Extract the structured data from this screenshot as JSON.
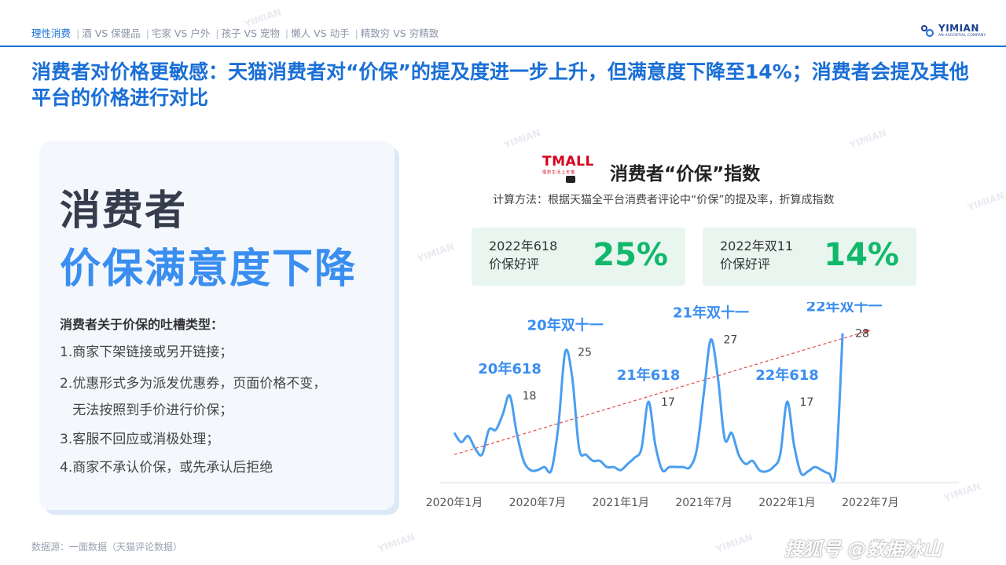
{
  "breadcrumb": {
    "active": "理性消费",
    "items": [
      "酒 VS 保健品",
      "宅家 VS 户外",
      "孩子 VS 宠物",
      "懒人 VS 动手",
      "精致穷 VS 穷精致"
    ]
  },
  "logo": {
    "name": "YIMIAN",
    "sub": "AN ASCENTIAL COMPANY"
  },
  "headline": "消费者对价格更敏感：天猫消费者对“价保”的提及度进一步上升，但满意度下降至14%；消费者会提及其他平台的价格进行对比",
  "left_panel": {
    "line1": "消费者",
    "line2": "价保满意度下降",
    "complaint_title": "消费者关于价保的吐槽类型：",
    "complaints": [
      "1.商家下架链接或另开链接；",
      "2.优惠形式多为派发优惠券，页面价格不变，",
      "   无法按照到手价进行价保；",
      "3.客服不回应或消极处理；",
      "4.商家不承认价保，或先承认后拒绝"
    ]
  },
  "tmall": {
    "word": "TMALL",
    "sub": "理想生活上天猫"
  },
  "chart_header": {
    "title": "消费者“价保”指数",
    "method": "计算方法：根据天猫全平台消费者评论中“价保”的提及率，折算成指数"
  },
  "kpis": [
    {
      "label_line1": "2022年618",
      "label_line2": "价保好评",
      "value": "25%"
    },
    {
      "label_line1": "2022年双11",
      "label_line2": "价保好评",
      "value": "14%"
    }
  ],
  "chart_data": {
    "type": "line",
    "x_tick_labels": [
      "2020年1月",
      "2020年7月",
      "2021年1月",
      "2021年7月",
      "2022年1月",
      "2022年7月"
    ],
    "x_range": [
      0,
      34
    ],
    "y_range": [
      4,
      32
    ],
    "series": [
      {
        "values": [
          [
            0,
            12
          ],
          [
            0.5,
            10.5
          ],
          [
            1,
            11.5
          ],
          [
            1.5,
            9.5
          ],
          [
            2,
            8.5
          ],
          [
            2.5,
            12.5
          ],
          [
            3,
            12.5
          ],
          [
            3.5,
            15
          ],
          [
            4,
            18
          ],
          [
            4.5,
            12
          ],
          [
            5,
            7.5
          ],
          [
            5.5,
            6
          ],
          [
            6,
            6
          ],
          [
            6.5,
            6.5
          ],
          [
            7,
            6
          ],
          [
            7.5,
            13
          ],
          [
            8,
            25
          ],
          [
            8.5,
            21
          ],
          [
            9,
            9.5
          ],
          [
            9.5,
            8.5
          ],
          [
            10,
            7.5
          ],
          [
            10.5,
            7.5
          ],
          [
            11,
            6.5
          ],
          [
            11.5,
            6.5
          ],
          [
            12,
            6
          ],
          [
            12.5,
            7
          ],
          [
            13,
            8
          ],
          [
            13.5,
            9.5
          ],
          [
            14,
            17
          ],
          [
            14.5,
            10
          ],
          [
            15,
            6
          ],
          [
            15.5,
            6.5
          ],
          [
            16,
            6.5
          ],
          [
            16.5,
            6.5
          ],
          [
            17,
            6.5
          ],
          [
            17.5,
            9.5
          ],
          [
            18,
            18.5
          ],
          [
            18.5,
            27
          ],
          [
            19,
            21
          ],
          [
            19.5,
            11
          ],
          [
            20,
            12
          ],
          [
            20.5,
            8.5
          ],
          [
            21,
            7
          ],
          [
            21.5,
            7.5
          ],
          [
            22,
            6
          ],
          [
            22.5,
            5.8
          ],
          [
            23,
            6.5
          ],
          [
            23.5,
            8.5
          ],
          [
            24,
            17
          ],
          [
            24.5,
            10
          ],
          [
            25,
            5.5
          ],
          [
            25.5,
            5.8
          ],
          [
            26,
            6.5
          ],
          [
            26.5,
            6
          ],
          [
            27,
            5.5
          ],
          [
            27.5,
            6
          ],
          [
            28,
            28
          ]
        ]
      }
    ],
    "trend_line": {
      "from": [
        0,
        8.5
      ],
      "to": [
        30,
        28.5
      ],
      "style": "dashed",
      "color": "#e24b4b"
    },
    "peak_labels": [
      {
        "label": "20年618",
        "value": "18",
        "at": [
          4,
          18
        ]
      },
      {
        "label": "20年双十一",
        "value": "25",
        "at": [
          8,
          25
        ]
      },
      {
        "label": "21年618",
        "value": "17",
        "at": [
          14,
          17
        ]
      },
      {
        "label": "21年双十一",
        "value": "27",
        "at": [
          18.5,
          27
        ]
      },
      {
        "label": "22年618",
        "value": "17",
        "at": [
          24,
          17
        ]
      },
      {
        "label": "22年双十一",
        "value": "28",
        "at": [
          28,
          28
        ]
      }
    ],
    "grid": false,
    "legend": "none"
  },
  "colors": {
    "accent": "#1a6fd6",
    "line": "#4a9ef0",
    "peak_label": "#3a8ef0",
    "trend": "#e24b4b",
    "kpi_value": "#11b86b"
  },
  "footer": {
    "source": "数据源：一面数据（天猫评论数据）",
    "watermark": "搜狐号 @数据冰山"
  },
  "watermark_text": "YIMIAN"
}
